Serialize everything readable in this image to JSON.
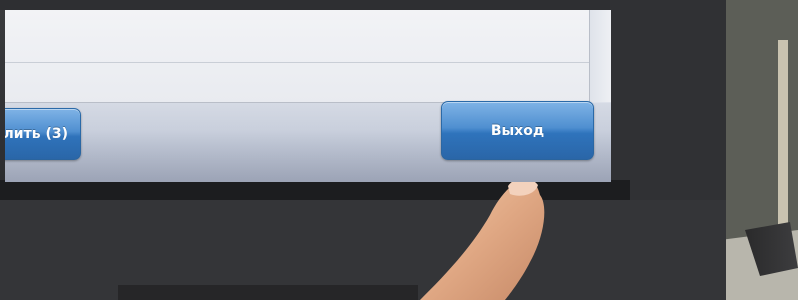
{
  "buttons": {
    "left_partial_label": "лить (3)",
    "exit_label": "Выход"
  },
  "colors": {
    "button_blue": "#3a7fc4",
    "bezel": "#2f3033",
    "screen_bg": "#e9ebf0"
  }
}
